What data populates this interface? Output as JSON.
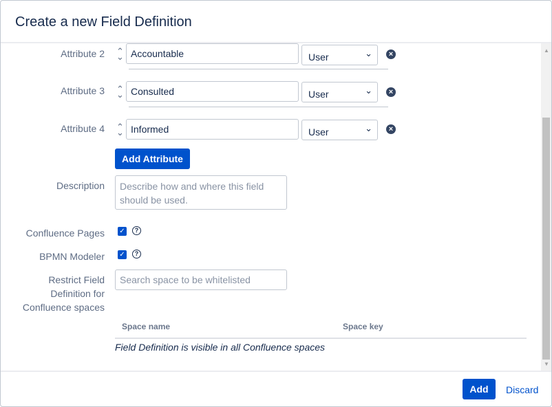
{
  "dialog": {
    "title": "Create a new Field Definition"
  },
  "attributes": [
    {
      "label": "Attribute 2",
      "value": "Accountable",
      "type": "User"
    },
    {
      "label": "Attribute 3",
      "value": "Consulted",
      "type": "User"
    },
    {
      "label": "Attribute 4",
      "value": "Informed",
      "type": "User"
    }
  ],
  "add_attribute_label": "Add Attribute",
  "description": {
    "label": "Description",
    "placeholder_line1": "Describe how and where this field",
    "placeholder_line2": "should be used."
  },
  "confluence_pages": {
    "label": "Confluence Pages",
    "checked": true
  },
  "bpmn_modeler": {
    "label": "BPMN Modeler",
    "checked": true
  },
  "restrict": {
    "label_line1": "Restrict Field",
    "label_line2": "Definition for",
    "label_line3": "Confluence spaces",
    "placeholder": "Search space to be whitelisted"
  },
  "table": {
    "columns": [
      "Space name",
      "Space key"
    ],
    "empty_message": "Field Definition is visible in all Confluence spaces"
  },
  "footer": {
    "add_label": "Add",
    "discard_label": "Discard"
  },
  "colors": {
    "primary": "#0052cc",
    "text": "#172b4d",
    "muted": "#5e6c84"
  }
}
